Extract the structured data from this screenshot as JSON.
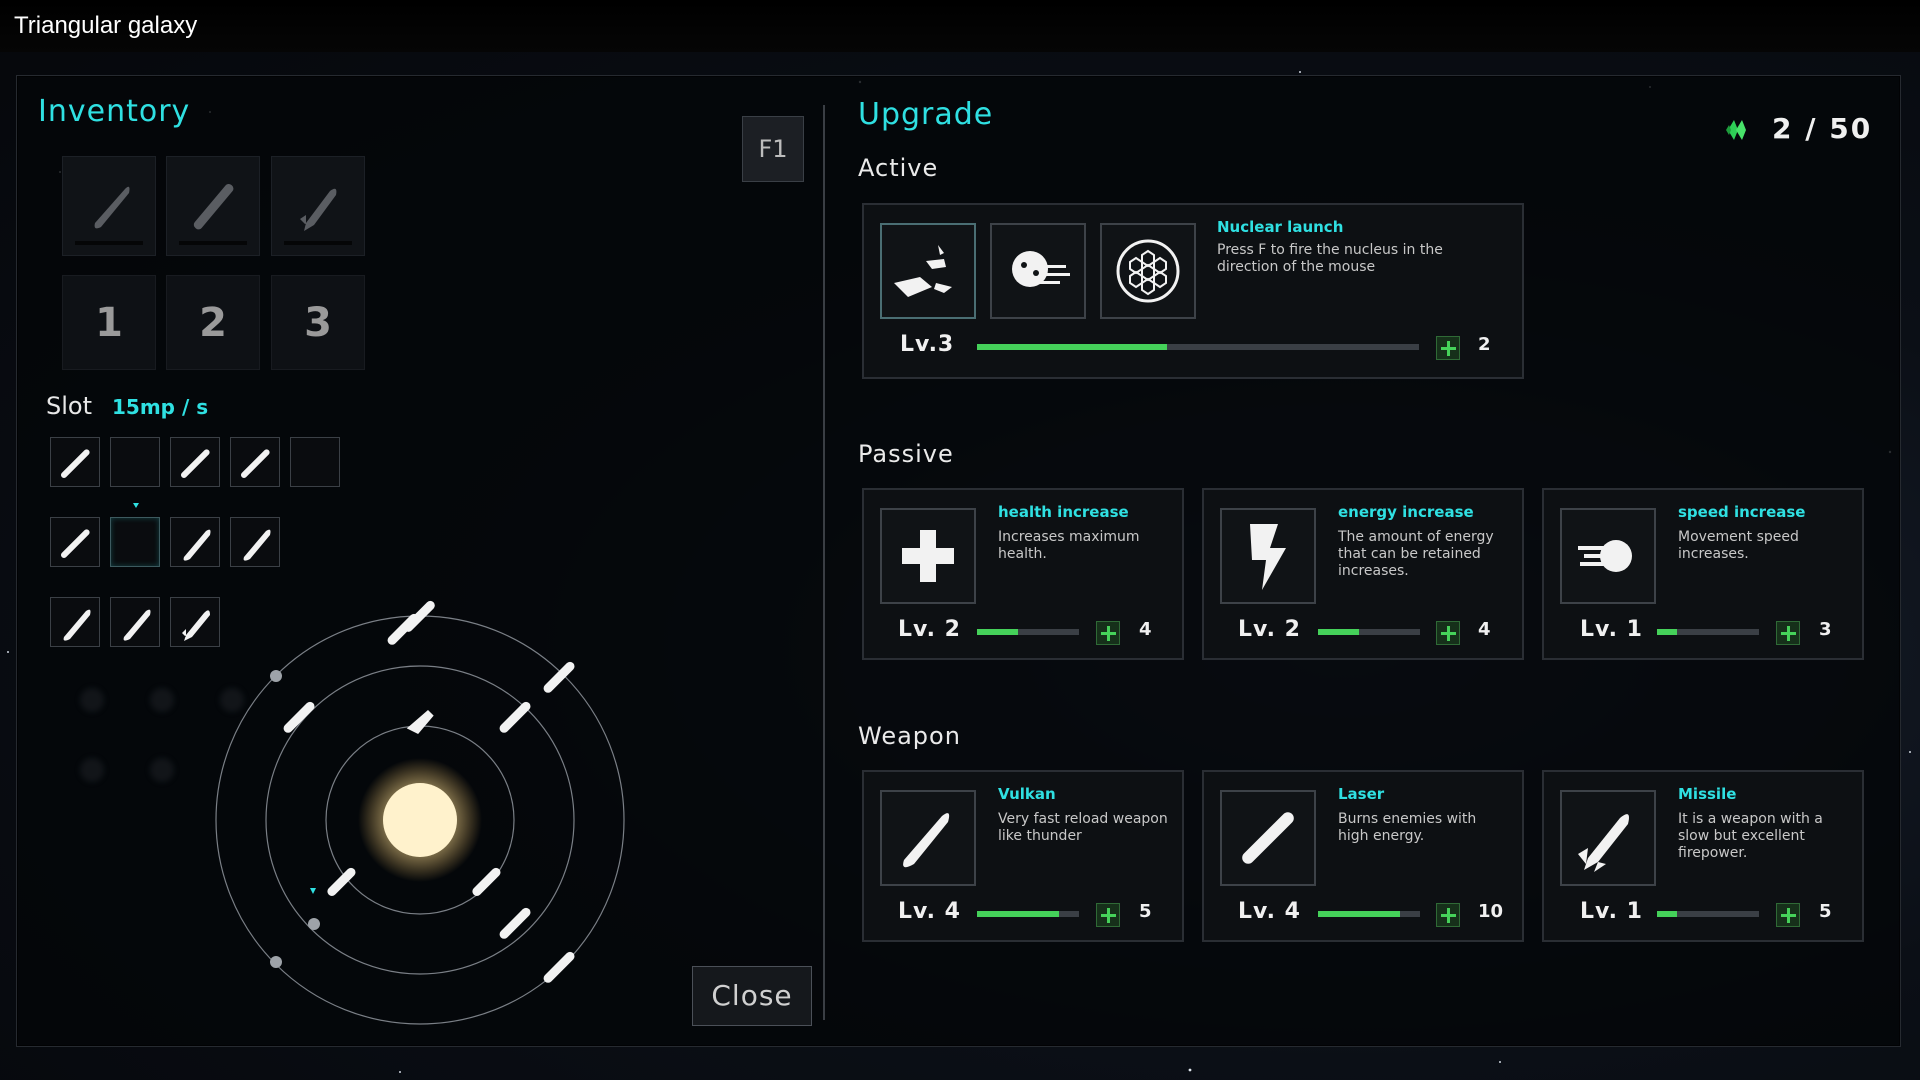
{
  "window_title": "Triangular galaxy",
  "colors": {
    "accent": "#2fe0e2",
    "progress": "#45d15a",
    "panel": "#0d1013"
  },
  "inventory": {
    "title": "Inventory",
    "hotkey": "F1",
    "quick_slots": [
      {
        "icon": "vulkan-weapon-icon"
      },
      {
        "icon": "laser-weapon-icon"
      },
      {
        "icon": "missile-weapon-icon"
      }
    ],
    "numbers": [
      "1",
      "2",
      "3"
    ],
    "slot_label": "Slot",
    "slot_rate": "15mp / s",
    "close_label": "Close"
  },
  "upgrade": {
    "title": "Upgrade",
    "points": "2 / 50",
    "active": {
      "heading": "Active",
      "skills": [
        {
          "icon": "asteroid-shards-icon"
        },
        {
          "icon": "nucleus-comet-icon"
        },
        {
          "icon": "hex-shield-icon"
        }
      ],
      "name": "Nuclear launch",
      "description": "Press F to fire the nucleus in the direction of the mouse",
      "level": "Lv.3",
      "progress": 0.43,
      "cost": "2"
    },
    "passive": {
      "heading": "Passive",
      "cards": [
        {
          "icon": "health-plus-icon",
          "name": "health increase",
          "description": "Increases maximum health.",
          "level": "Lv. 2",
          "progress": 0.4,
          "cost": "4"
        },
        {
          "icon": "lightning-icon",
          "name": "energy increase",
          "description": "The amount of energy that can be retained increases.",
          "level": "Lv. 2",
          "progress": 0.4,
          "cost": "4"
        },
        {
          "icon": "speed-dash-icon",
          "name": "speed increase",
          "description": "Movement speed increases.",
          "level": "Lv. 1",
          "progress": 0.2,
          "cost": "3"
        }
      ]
    },
    "weapon": {
      "heading": "Weapon",
      "cards": [
        {
          "icon": "vulkan-weapon-icon",
          "name": "Vulkan",
          "description": "Very fast reload weapon like thunder",
          "level": "Lv. 4",
          "progress": 0.8,
          "cost": "5"
        },
        {
          "icon": "laser-weapon-icon",
          "name": "Laser",
          "description": "Burns enemies with high energy.",
          "level": "Lv. 4",
          "progress": 0.8,
          "cost": "10"
        },
        {
          "icon": "missile-weapon-icon",
          "name": "Missile",
          "description": "It is a weapon with a slow but excellent firepower.",
          "level": "Lv. 1",
          "progress": 0.2,
          "cost": "5"
        }
      ]
    }
  }
}
